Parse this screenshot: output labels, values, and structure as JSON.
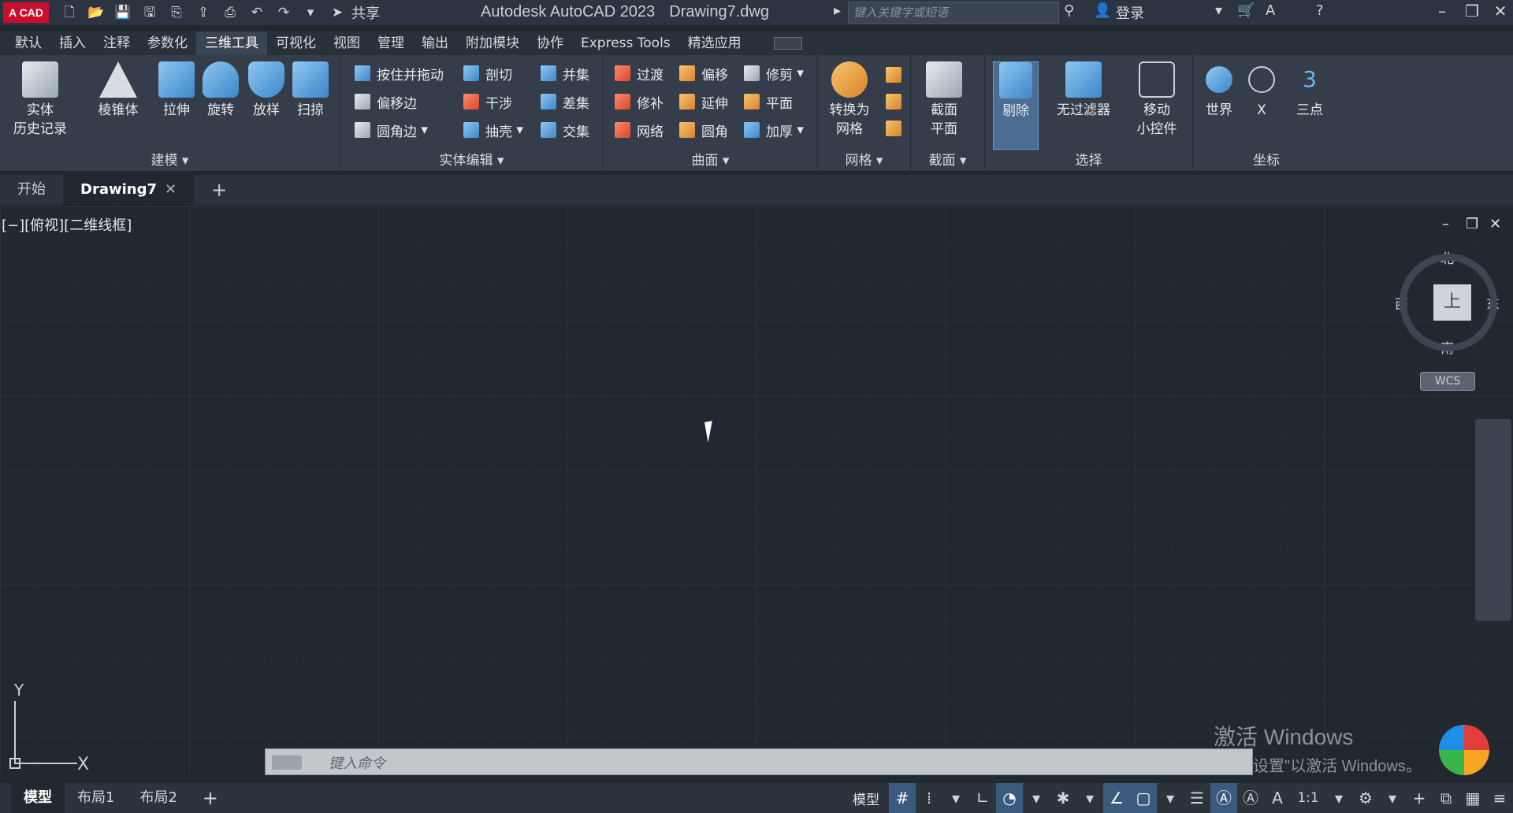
{
  "titlebar": {
    "logo": "A CAD",
    "share": "共享",
    "app_title": "Autodesk AutoCAD 2023",
    "doc_title": "Drawing7.dwg",
    "search_placeholder": "键入关键字或短语",
    "login": "登录"
  },
  "ribbon_tabs": [
    "默认",
    "插入",
    "注释",
    "参数化",
    "三维工具",
    "可视化",
    "视图",
    "管理",
    "输出",
    "附加模块",
    "协作",
    "Express Tools",
    "精选应用"
  ],
  "active_tab": "三维工具",
  "panels": {
    "modeling": {
      "title": "建模",
      "solid_history": "实体\n历史记录",
      "buttons": [
        "棱锥体",
        "拉伸",
        "旋转",
        "放样",
        "扫掠"
      ]
    },
    "solid_edit": {
      "title": "实体编辑",
      "col1": [
        "按住并拖动",
        "偏移边",
        "圆角边"
      ],
      "col2": [
        "剖切",
        "干涉",
        "抽壳"
      ],
      "col3": [
        "并集",
        "差集",
        "交集"
      ]
    },
    "surface": {
      "title": "曲面",
      "col1": [
        "过渡",
        "修补",
        "网络"
      ],
      "col2": [
        "偏移",
        "延伸",
        "圆角"
      ],
      "col3": [
        "修剪",
        "平面",
        "加厚"
      ]
    },
    "mesh": {
      "title": "网格",
      "convert": "转换为\n网格"
    },
    "section": {
      "title": "截面",
      "plane": "截面\n平面"
    },
    "selection": {
      "title": "选择",
      "culling": "剔除",
      "no_filter": "无过滤器",
      "gizmo": "移动\n小控件"
    },
    "coordinates": {
      "title": "坐标",
      "world": "世界",
      "x": "X",
      "three_point": "三点"
    }
  },
  "doc_tabs": {
    "start": "开始",
    "active": "Drawing7"
  },
  "viewport": {
    "label": "[−][俯视][二维线框]",
    "north": "北",
    "south": "南",
    "east": "东",
    "west": "西",
    "top": "上",
    "wcs": "WCS",
    "ucs_y": "Y",
    "ucs_x": "X"
  },
  "watermark": {
    "line1": "激活 Windows",
    "line2": "设置\"以激活 Windows。"
  },
  "command": {
    "placeholder": "键入命令"
  },
  "layout_tabs": [
    "模型",
    "布局1",
    "布局2"
  ],
  "status": {
    "model": "模型",
    "scale": "1:1"
  }
}
